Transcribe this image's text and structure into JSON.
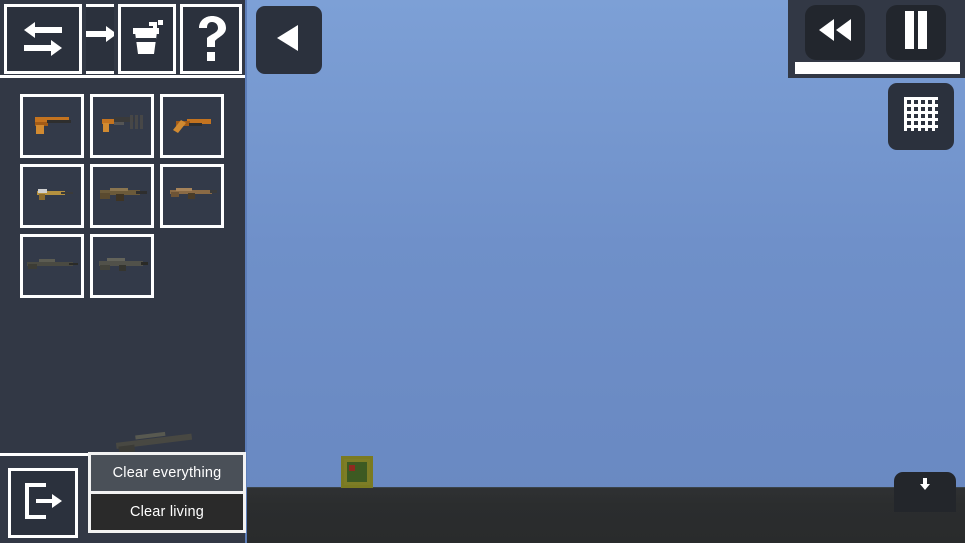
{
  "app": {
    "title": "Sandbox Weapon Spawner",
    "sky_color": "#6e8fc8",
    "ground_color": "#2b2d2e",
    "panel_color": "#323845",
    "accent_color": "#ffffff"
  },
  "toolbar": {
    "buttons": [
      {
        "id": "swap",
        "icon": "swap-arrows-icon",
        "label": "Swap"
      },
      {
        "id": "next",
        "icon": "arrow-right-icon",
        "label": "Next"
      },
      {
        "id": "paint",
        "icon": "paint-bucket-icon",
        "label": "Paint"
      },
      {
        "id": "help",
        "icon": "question-mark-icon",
        "label": "Help"
      }
    ]
  },
  "item_grid": {
    "slots": [
      {
        "index": 1,
        "name": "Pistol",
        "sprite": "pistol",
        "color": "#c4731f"
      },
      {
        "index": 2,
        "name": "Machine Pistol",
        "sprite": "machine-pistol",
        "color": "#c4731f"
      },
      {
        "index": 3,
        "name": "Sawed-off Shotgun",
        "sprite": "sawed-off",
        "color": "#c4731f"
      },
      {
        "index": 4,
        "name": "Submachine Gun",
        "sprite": "smg",
        "color": "#b5913f"
      },
      {
        "index": 5,
        "name": "Assault Rifle",
        "sprite": "assault-rifle",
        "color": "#6b5a3a"
      },
      {
        "index": 6,
        "name": "Carbine",
        "sprite": "carbine",
        "color": "#8a6a45"
      },
      {
        "index": 7,
        "name": "Sniper Rifle",
        "sprite": "sniper-rifle",
        "color": "#4a4a42"
      },
      {
        "index": 8,
        "name": "Battle Rifle",
        "sprite": "battle-rifle",
        "color": "#51514a"
      }
    ]
  },
  "drag_preview": {
    "name": "Sniper Rifle",
    "sprite": "sniper-rifle"
  },
  "bottom": {
    "exit_button": {
      "icon": "exit-door-icon",
      "label": "Exit"
    }
  },
  "context_menu": {
    "items": [
      {
        "label": "Clear everything",
        "state": "hovered"
      },
      {
        "label": "Clear living",
        "state": "normal"
      }
    ]
  },
  "hud": {
    "collapse_button": {
      "icon": "triangle-left-icon",
      "label": "Collapse panel"
    },
    "rewind_button": {
      "icon": "rewind-icon",
      "label": "Rewind"
    },
    "pause_button": {
      "icon": "pause-icon",
      "label": "Pause"
    },
    "timeline": {
      "label": "Timeline",
      "progress": 100
    },
    "grid_toggle": {
      "icon": "grid-icon",
      "label": "Toggle grid"
    },
    "save_button": {
      "icon": "download-icon",
      "label": "Save"
    }
  },
  "world": {
    "entity": {
      "name": "Spawned entity",
      "color": "#7d7d26"
    }
  }
}
